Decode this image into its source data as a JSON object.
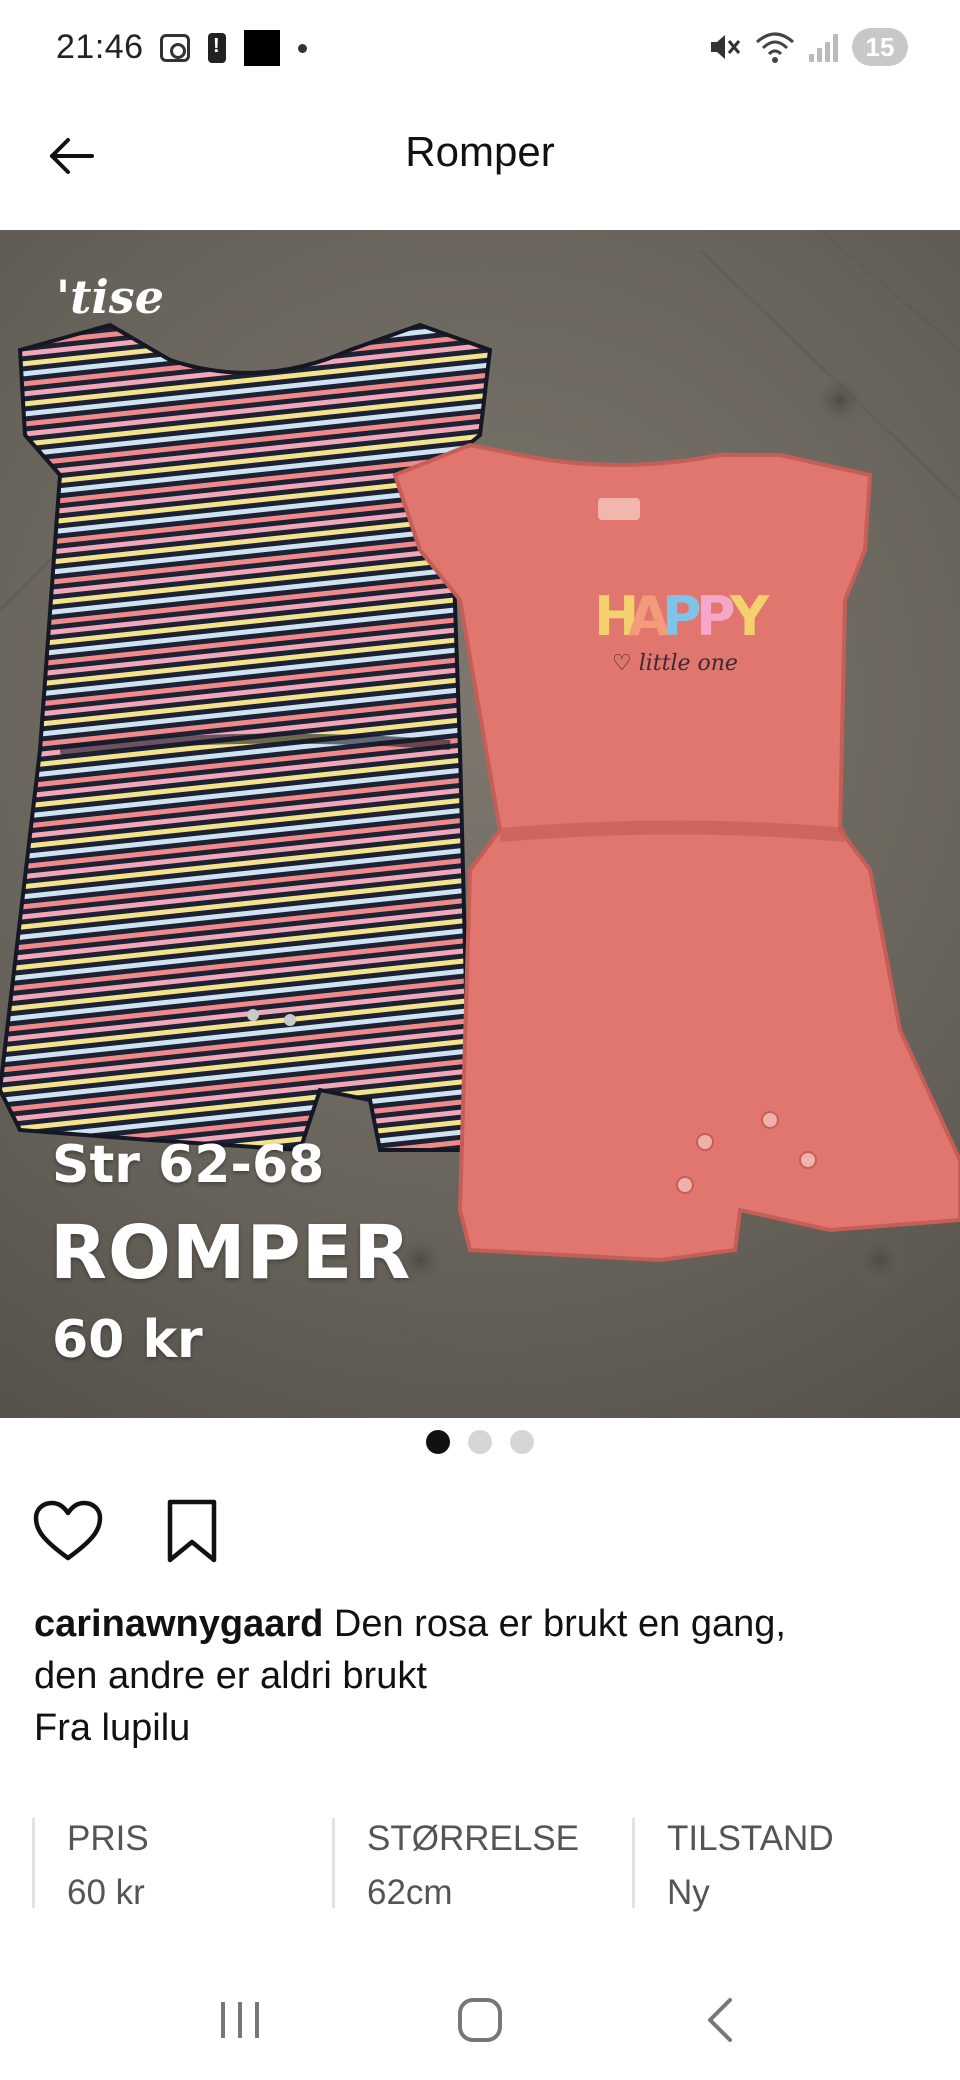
{
  "status_bar": {
    "time": "21:46",
    "battery_level": "15",
    "icons": [
      "screenshot-icon",
      "battery-alert-icon",
      "app-notification-icon",
      "notification-dot-icon",
      "mute-icon",
      "wifi-icon",
      "signal-icon",
      "battery-icon"
    ]
  },
  "app_bar": {
    "title": "Romper",
    "back_icon": "arrow-left-icon"
  },
  "hero": {
    "watermark": "'tise",
    "overlay_size": "Str 62-68",
    "overlay_title": "ROMPER",
    "overlay_price": "60 kr",
    "image_count": 3,
    "active_index": 0
  },
  "actions": {
    "like_icon": "heart-icon",
    "save_icon": "bookmark-icon"
  },
  "description": {
    "username": "carinawnygaard",
    "text_line1": " Den rosa er brukt en gang,",
    "text_line2": "den andre er aldri brukt",
    "text_line3": "Fra lupilu"
  },
  "attributes": [
    {
      "label": "PRIS",
      "value": "60 kr"
    },
    {
      "label": "STØRRELSE",
      "value": "62cm"
    },
    {
      "label": "TILSTAND",
      "value": "Ny"
    }
  ],
  "nav_bar": {
    "icons": [
      "recent-apps-icon",
      "home-icon",
      "back-icon"
    ]
  },
  "colors": {
    "pink_romper": "#e0766e",
    "navy_romper": "#1c2233",
    "couch": "#6e685f"
  }
}
